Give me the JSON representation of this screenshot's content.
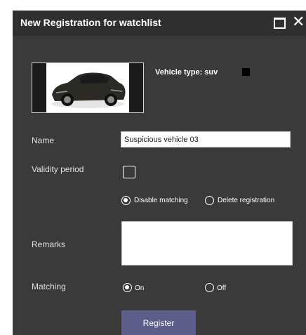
{
  "dialog": {
    "title": "New Registration for watchlist",
    "maximize_icon": "maximize-icon",
    "close_icon": "close-icon",
    "close_glyph": "✕"
  },
  "vehicle": {
    "image_icon": "car-thumbnail",
    "type_label": "Vehicle type: suv",
    "color": "#000000"
  },
  "form": {
    "name_label": "Name",
    "name_value": "Suspicious vehicle 03",
    "validity_label": "Validity period",
    "validity_checked": false,
    "expiry_options": [
      {
        "label": "Disable matching",
        "checked": true
      },
      {
        "label": "Delete registration",
        "checked": false
      }
    ],
    "remarks_label": "Remarks",
    "remarks_value": "",
    "matching_label": "Matching",
    "matching_options": [
      {
        "label": "On",
        "checked": true
      },
      {
        "label": "Off",
        "checked": false
      }
    ],
    "register_label": "Register"
  },
  "colors": {
    "dialog_bg": "#3a3a3a",
    "titlebar_bg": "#2f2f2f",
    "button_bg": "#5d5d8a"
  }
}
